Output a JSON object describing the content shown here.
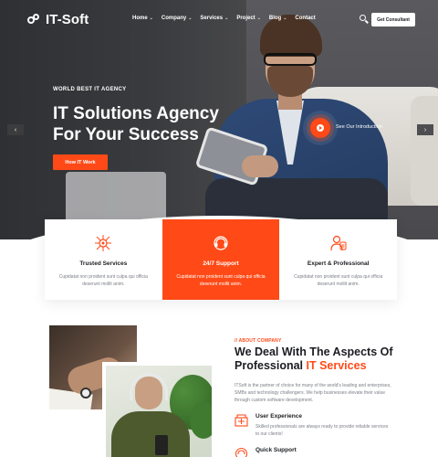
{
  "brand": {
    "name": "IT-Soft"
  },
  "nav": {
    "items": [
      {
        "label": "Home",
        "chevron": "chevron-down-icon"
      },
      {
        "label": "Company",
        "chevron": "chevron-down-icon"
      },
      {
        "label": "Services",
        "chevron": "chevron-down-icon"
      },
      {
        "label": "Project",
        "chevron": "chevron-down-icon"
      },
      {
        "label": "Blog",
        "chevron": "chevron-down-icon"
      },
      {
        "label": "Contact"
      }
    ],
    "cta_label": "Get Consultant"
  },
  "hero": {
    "tag": "WORLD BEST IT AGENCY",
    "title_line1": "IT Solutions Agency",
    "title_line2": "For Your Success",
    "button_label": "How IT Work",
    "video_label": "See Our Introduction",
    "prev_arrow": "‹",
    "next_arrow": "›"
  },
  "services": [
    {
      "title": "Trusted Services",
      "text": "Cupidatat non proident sunt culpa qui officia deserunt mollit anim.",
      "icon": "network-icon",
      "active": false
    },
    {
      "title": "24/7 Support",
      "text": "Cupidatat non proident sunt culpa qui officia deserunt mollit anim.",
      "icon": "support-icon",
      "active": true
    },
    {
      "title": "Expert & Professional",
      "text": "Cupidatat non proident sunt culpa qui officia deserunt mollit anim.",
      "icon": "expert-icon",
      "active": false
    }
  ],
  "about": {
    "tag": "// ABOUT COMPANY",
    "title_line1": "We Deal With The Aspects Of",
    "title_line2_plain": "Professional ",
    "title_line2_highlight": "IT Services",
    "text": "ITSoft is the partner of choice for many of the world's leading and enterprises, SMBs and technology challengers. We help businesses elevate their value through custom software development.",
    "features": [
      {
        "title": "User Experience",
        "text": "Skilled professionals are always ready to provide reliable services to our clients!",
        "icon": "user-experience-icon"
      },
      {
        "title": "Quick Support",
        "text": "",
        "icon": "quick-support-icon"
      }
    ]
  },
  "colors": {
    "accent": "#ff4a17",
    "dark": "#1b1d21",
    "muted": "#7a7e85"
  }
}
